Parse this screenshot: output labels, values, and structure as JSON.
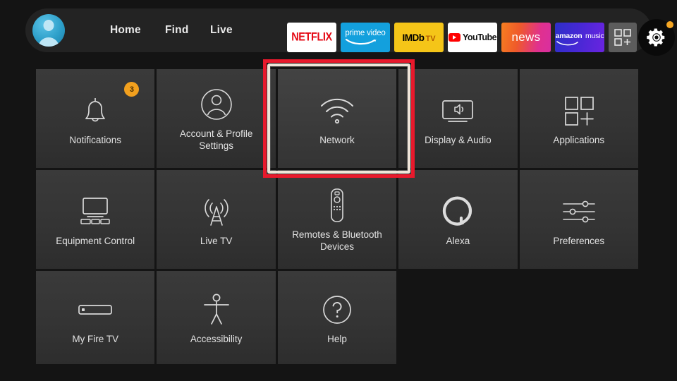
{
  "header": {
    "avatar": "profile-avatar",
    "nav": [
      {
        "label": "Home"
      },
      {
        "label": "Find"
      },
      {
        "label": "Live"
      }
    ],
    "apps": [
      {
        "id": "netflix",
        "label": "NETFLIX",
        "bg": "#ffffff",
        "fg": "#e50914"
      },
      {
        "id": "prime",
        "label": "prime video",
        "bg": "#13a0dd",
        "fg": "#ffffff"
      },
      {
        "id": "imdb",
        "label": "IMDb",
        "sub": "TV",
        "bg": "#f5c518",
        "fg": "#000000"
      },
      {
        "id": "youtube",
        "label": "YouTube",
        "bg": "#ffffff",
        "fg": "#111111"
      },
      {
        "id": "news",
        "label": "news",
        "bg": "#ef5a2a",
        "fg": "#ffffff"
      },
      {
        "id": "music",
        "label": "amazon",
        "sub": "music",
        "bg": "#4528d4",
        "fg": "#ffffff"
      },
      {
        "id": "grid",
        "label": "apps-grid-icon",
        "bg": "#5c5c5c"
      }
    ],
    "settings": {
      "icon": "gear-icon",
      "has_notification_dot": true,
      "dot_color": "#f5a623"
    }
  },
  "grid": {
    "tiles": [
      {
        "id": "notifications",
        "label": "Notifications",
        "icon": "bell-icon",
        "badge": "3"
      },
      {
        "id": "account",
        "label": "Account & Profile Settings",
        "icon": "person-icon"
      },
      {
        "id": "network",
        "label": "Network",
        "icon": "wifi-icon",
        "selected": true
      },
      {
        "id": "display",
        "label": "Display & Audio",
        "icon": "tv-speaker-icon"
      },
      {
        "id": "applications",
        "label": "Applications",
        "icon": "apps-squares-icon"
      },
      {
        "id": "equipment",
        "label": "Equipment Control",
        "icon": "tv-devices-icon"
      },
      {
        "id": "livetv",
        "label": "Live TV",
        "icon": "antenna-icon"
      },
      {
        "id": "remotes",
        "label": "Remotes & Bluetooth Devices",
        "icon": "remote-icon"
      },
      {
        "id": "alexa",
        "label": "Alexa",
        "icon": "alexa-ring-icon"
      },
      {
        "id": "preferences",
        "label": "Preferences",
        "icon": "sliders-icon"
      },
      {
        "id": "myfiretv",
        "label": "My Fire TV",
        "icon": "firestick-icon"
      },
      {
        "id": "accessibility",
        "label": "Accessibility",
        "icon": "accessibility-icon"
      },
      {
        "id": "help",
        "label": "Help",
        "icon": "question-circle-icon"
      }
    ]
  },
  "annotation": {
    "type": "red-highlight-box",
    "target": "network",
    "color": "#e8192c"
  }
}
